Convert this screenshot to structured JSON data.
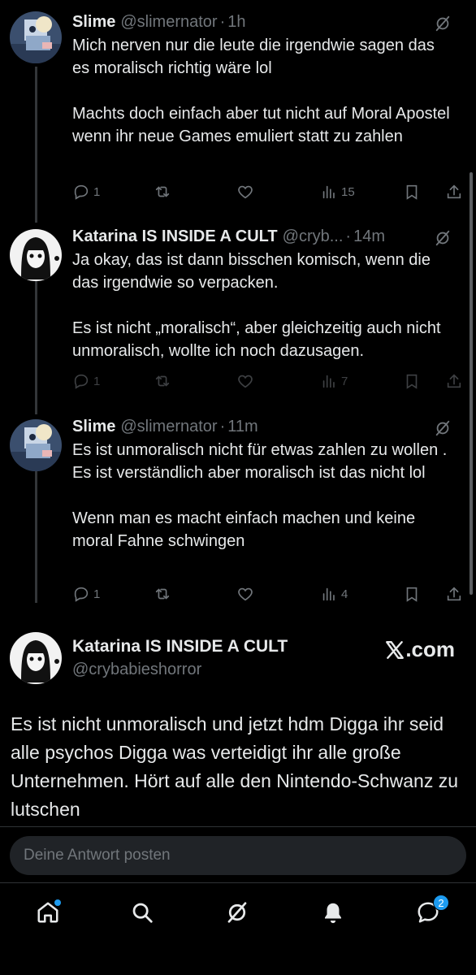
{
  "tweets": [
    {
      "name": "Slime",
      "handle": "@slimernator",
      "time": "1h",
      "text": "Mich nerven nur die leute die irgendwie sagen das es moralisch richtig wäre lol\n\nMachts doch einfach aber tut nicht auf Moral Apostel wenn ihr neue Games emuliert statt zu zahlen",
      "replies": "1",
      "views": "15"
    },
    {
      "name": "Katarina IS INSIDE A CULT",
      "handle": "@cryb...",
      "time": "14m",
      "text": "Ja okay, das ist dann bisschen komisch, wenn die das irgendwie so verpacken.\n\nEs ist nicht „moralisch“, aber gleichzeitig auch nicht unmoralisch, wollte ich noch dazusagen.",
      "replies": "1",
      "views": "7"
    },
    {
      "name": "Slime",
      "handle": "@slimernator",
      "time": "11m",
      "text": "Es ist unmoralisch nicht für etwas zahlen zu wollen . Es ist verständlich aber moralisch ist das nicht lol\n\nWenn man es macht einfach machen und keine moral Fahne schwingen",
      "replies": "1",
      "views": "4"
    }
  ],
  "main_tweet": {
    "name": "Katarina IS INSIDE A CULT",
    "handle": "@crybabieshorror",
    "source": ".com",
    "text": "Es ist nicht unmoralisch und jetzt hdm Digga ihr seid alle psychos Digga was verteidigt ihr alle große Unternehmen. Hört auf alle den Nintendo-Schwanz zu lutschen"
  },
  "reply": {
    "placeholder": "Deine Antwort posten"
  },
  "nav": {
    "messages_badge": "2"
  },
  "colors": {
    "background": "#000000",
    "text": "#e7e9ea",
    "muted": "#71767b",
    "accent": "#1d9bf0"
  }
}
